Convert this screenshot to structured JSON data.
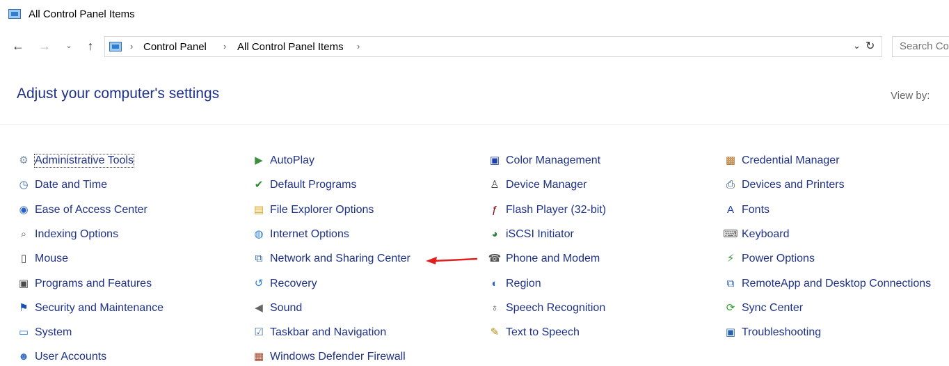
{
  "window": {
    "title": "All Control Panel Items"
  },
  "nav": {
    "back_icon": "←",
    "forward_icon": "→",
    "recent_icon": "⌄",
    "up_icon": "↑",
    "breadcrumb": [
      "Control Panel",
      "All Control Panel Items"
    ],
    "separator": "›",
    "dropdown_icon": "⌄",
    "refresh_icon": "↻",
    "search_placeholder": "Search Co"
  },
  "header": {
    "title": "Adjust your computer's settings",
    "view_by_label": "View by:"
  },
  "columns": [
    [
      {
        "label": "Administrative Tools",
        "icon": "admin-tools-icon",
        "glyph": "⚙",
        "color": "#7a8fa8",
        "focused": true
      },
      {
        "label": "Date and Time",
        "icon": "clock-icon",
        "glyph": "◷",
        "color": "#3d6fb0"
      },
      {
        "label": "Ease of Access Center",
        "icon": "ease-of-access-icon",
        "glyph": "◉",
        "color": "#2a62c9"
      },
      {
        "label": "Indexing Options",
        "icon": "indexing-icon",
        "glyph": "⌕",
        "color": "#6a6a6a"
      },
      {
        "label": "Mouse",
        "icon": "mouse-icon",
        "glyph": "▯",
        "color": "#444444"
      },
      {
        "label": "Programs and Features",
        "icon": "programs-icon",
        "glyph": "▣",
        "color": "#4a4a4a"
      },
      {
        "label": "Security and Maintenance",
        "icon": "flag-icon",
        "glyph": "⚑",
        "color": "#1d4fb0"
      },
      {
        "label": "System",
        "icon": "monitor-icon",
        "glyph": "▭",
        "color": "#2a7ad6"
      },
      {
        "label": "User Accounts",
        "icon": "users-icon",
        "glyph": "☻",
        "color": "#3a6fc4"
      }
    ],
    [
      {
        "label": "AutoPlay",
        "icon": "autoplay-icon",
        "glyph": "▶",
        "color": "#3c8d3c"
      },
      {
        "label": "Default Programs",
        "icon": "default-programs-icon",
        "glyph": "✔",
        "color": "#2e8b2e"
      },
      {
        "label": "File Explorer Options",
        "icon": "folder-options-icon",
        "glyph": "▤",
        "color": "#d8a520"
      },
      {
        "label": "Internet Options",
        "icon": "globe-icon",
        "glyph": "◍",
        "color": "#2f7fc8"
      },
      {
        "label": "Network and Sharing Center",
        "icon": "network-icon",
        "glyph": "⧉",
        "color": "#2a62a8"
      },
      {
        "label": "Recovery",
        "icon": "recovery-icon",
        "glyph": "↺",
        "color": "#2a7ad6"
      },
      {
        "label": "Sound",
        "icon": "speaker-icon",
        "glyph": "◀",
        "color": "#666666"
      },
      {
        "label": "Taskbar and Navigation",
        "icon": "taskbar-icon",
        "glyph": "☑",
        "color": "#4a6fa0"
      },
      {
        "label": "Windows Defender Firewall",
        "icon": "firewall-icon",
        "glyph": "▦",
        "color": "#a0452a"
      }
    ],
    [
      {
        "label": "Color Management",
        "icon": "color-management-icon",
        "glyph": "▣",
        "color": "#1d3fb0"
      },
      {
        "label": "Device Manager",
        "icon": "device-manager-icon",
        "glyph": "♙",
        "color": "#444444"
      },
      {
        "label": "Flash Player (32-bit)",
        "icon": "flash-icon",
        "glyph": "ƒ",
        "color": "#8b0000"
      },
      {
        "label": "iSCSI Initiator",
        "icon": "iscsi-icon",
        "glyph": "◕",
        "color": "#2f7f3f"
      },
      {
        "label": "Phone and Modem",
        "icon": "phone-icon",
        "glyph": "☎",
        "color": "#555555"
      },
      {
        "label": "Region",
        "icon": "region-icon",
        "glyph": "◐",
        "color": "#2a62c9"
      },
      {
        "label": "Speech Recognition",
        "icon": "microphone-icon",
        "glyph": "♁",
        "color": "#555555"
      },
      {
        "label": "Text to Speech",
        "icon": "text-to-speech-icon",
        "glyph": "✎",
        "color": "#b8860b"
      }
    ],
    [
      {
        "label": "Credential Manager",
        "icon": "credential-icon",
        "glyph": "▩",
        "color": "#b07020"
      },
      {
        "label": "Devices and Printers",
        "icon": "printer-icon",
        "glyph": "⎙",
        "color": "#2a4a7a"
      },
      {
        "label": "Fonts",
        "icon": "fonts-icon",
        "glyph": "A",
        "color": "#1d3fb0"
      },
      {
        "label": "Keyboard",
        "icon": "keyboard-icon",
        "glyph": "⌨",
        "color": "#666666"
      },
      {
        "label": "Power Options",
        "icon": "power-icon",
        "glyph": "⚡",
        "color": "#3c8d3c"
      },
      {
        "label": "RemoteApp and Desktop Connections",
        "icon": "remoteapp-icon",
        "glyph": "⧉",
        "color": "#2a62c9"
      },
      {
        "label": "Sync Center",
        "icon": "sync-icon",
        "glyph": "⟳",
        "color": "#2e9b2e"
      },
      {
        "label": "Troubleshooting",
        "icon": "troubleshooting-icon",
        "glyph": "▣",
        "color": "#2a62a8"
      }
    ]
  ],
  "annotation": {
    "arrow_color": "#e02020"
  }
}
